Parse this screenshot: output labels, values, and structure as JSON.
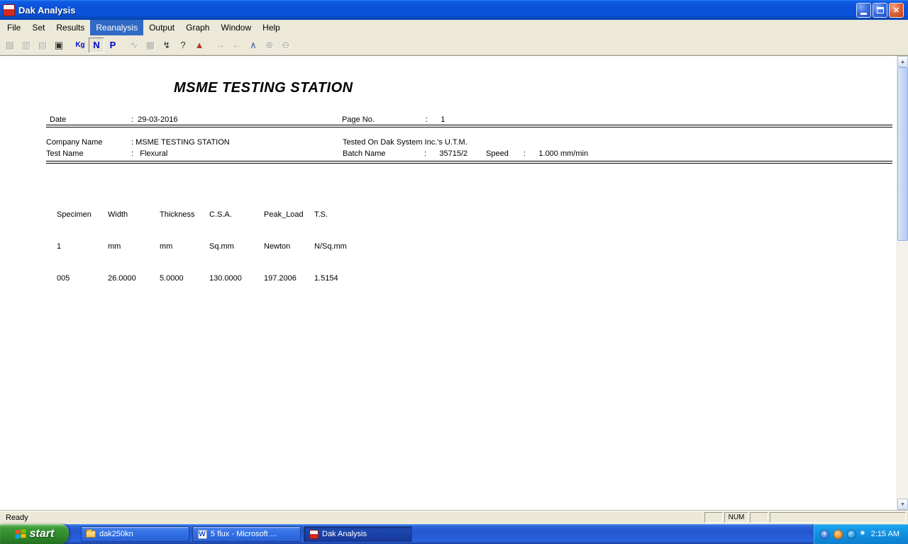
{
  "titlebar": {
    "title": "Dak Analysis",
    "controls": {
      "close": "✕"
    }
  },
  "menu": {
    "items": [
      "File",
      "Set",
      "Results",
      "Reanalysis",
      "Output",
      "Graph",
      "Window",
      "Help"
    ],
    "active_item": "Reanalysis"
  },
  "toolbar": {
    "buttons": [
      {
        "name": "chart-report",
        "glyph": "▧"
      },
      {
        "name": "results-grid",
        "glyph": "▥"
      },
      {
        "name": "data-sheet",
        "glyph": "▤"
      },
      {
        "name": "copy",
        "glyph": "▣"
      },
      {
        "name": "units-kg",
        "glyph": "Kg"
      },
      {
        "name": "units-newton",
        "glyph": "N"
      },
      {
        "name": "units-pound",
        "glyph": "P"
      },
      {
        "name": "curve",
        "glyph": "∿"
      },
      {
        "name": "grid",
        "glyph": "▦"
      },
      {
        "name": "analyze",
        "glyph": "↯"
      },
      {
        "name": "context-help",
        "glyph": "?"
      },
      {
        "name": "graph",
        "glyph": "▲"
      },
      {
        "name": "next",
        "glyph": "→"
      },
      {
        "name": "previous",
        "glyph": "←"
      },
      {
        "name": "peak-graph",
        "glyph": "∧"
      },
      {
        "name": "zoom-in",
        "glyph": "⊕"
      },
      {
        "name": "zoom-out",
        "glyph": "⊖"
      }
    ]
  },
  "report": {
    "title": "MSME TESTING STATION",
    "date_label": "Date",
    "date_value": ":  29-03-2016",
    "page_label": "Page No.",
    "page_value": ":      1",
    "company_label": "Company Name",
    "company_value": ": MSME TESTING STATION",
    "tested_on": "Tested On Dak System Inc.'s U.T.M.",
    "test_label": "Test Name",
    "test_value": ":   Flexural",
    "batch_label": "Batch Name",
    "batch_value": ":      35715/2",
    "speed_label": "Speed",
    "speed_value": ":      1.000 mm/min",
    "table": {
      "columns": [
        {
          "name": "Specimen",
          "unit": "1",
          "value": "005"
        },
        {
          "name": "Width",
          "unit": "mm",
          "value": "26.0000"
        },
        {
          "name": "Thickness",
          "unit": "mm",
          "value": "5.0000"
        },
        {
          "name": "C.S.A.",
          "unit": "Sq.mm",
          "value": "130.0000"
        },
        {
          "name": "Peak_Load",
          "unit": "Newton",
          "value": "197.2006"
        },
        {
          "name": "T.S.",
          "unit": "N/Sq.mm",
          "value": "1.5154"
        }
      ]
    }
  },
  "scrollbar": {
    "up": "▲",
    "down": "▼"
  },
  "statusbar": {
    "message": "Ready",
    "num": "NUM"
  },
  "taskbar": {
    "start": "start",
    "word_icon_glyph": "W",
    "tasks": [
      {
        "label": "dak250kn"
      },
      {
        "label": "5 flux - Microsoft ..."
      },
      {
        "label": "Dak Analysis"
      }
    ],
    "tray_chevron": "‹",
    "tray_star": "*",
    "clock": "2:15 AM"
  }
}
